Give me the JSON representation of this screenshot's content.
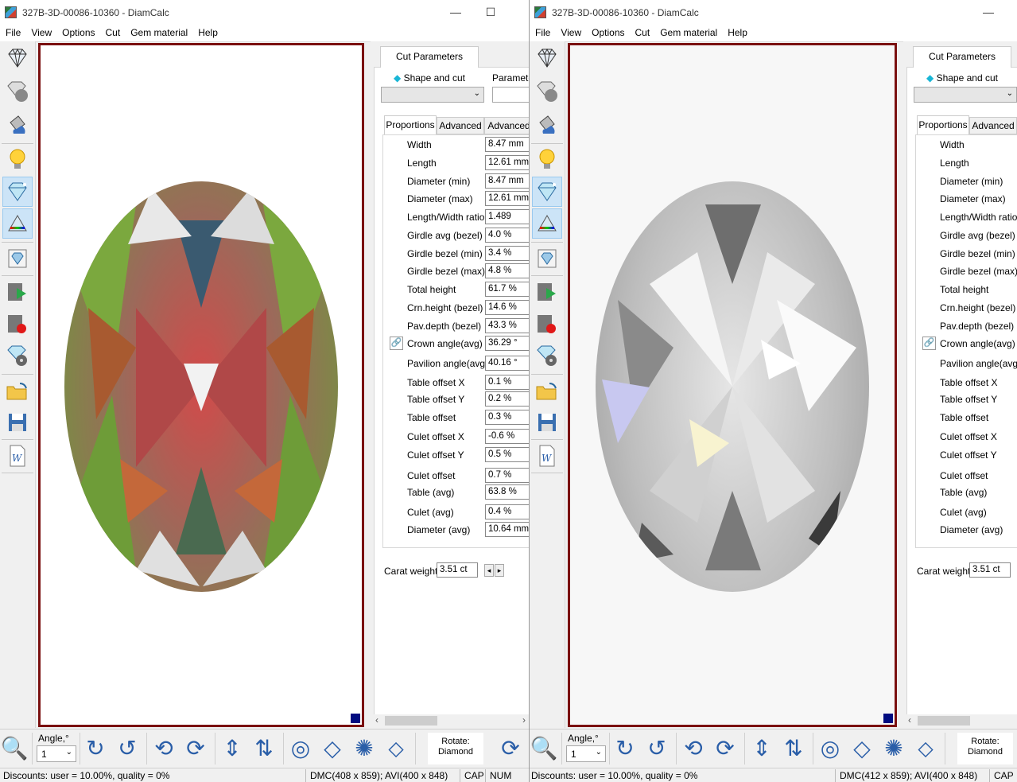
{
  "app": {
    "title": "327B-3D-00086-10360 - DiamCalc",
    "minimize_glyph": "—",
    "maximize_glyph": "☐",
    "menu": [
      "File",
      "View",
      "Options",
      "Cut",
      "Gem material",
      "Help"
    ]
  },
  "toolbar": {
    "icons": [
      "diamond-wireframe-icon",
      "diamond-sphere-icon",
      "paint-bucket-icon",
      "light-bulb-icon",
      "diamond-sparkle-icon",
      "spectrum-prism-icon",
      "diamond-picture-icon",
      "video-play-icon",
      "video-record-icon",
      "diamond-film-reel-icon",
      "open-folder-icon",
      "save-floppy-icon",
      "word-document-icon"
    ]
  },
  "panel": {
    "tab_cut_parameters": "Cut Parameters",
    "shape_and_cut_label": "Shape and cut",
    "parameters_label": "Parameter",
    "subtabs": [
      "Proportions",
      "Advanced",
      "Advanced"
    ],
    "rows": [
      {
        "label": "Width",
        "value": "8.47 mm"
      },
      {
        "label": "Length",
        "value": "12.61 mm"
      },
      {
        "label": "Diameter (min)",
        "value": "8.47 mm"
      },
      {
        "label": "Diameter (max)",
        "value": "12.61 mm"
      },
      {
        "label": "Length/Width ratio",
        "value": "1.489"
      },
      {
        "label": "Girdle avg (bezel)",
        "value": "4.0 %"
      },
      {
        "label": "Girdle bezel (min)",
        "value": "3.4 %"
      },
      {
        "label": "Girdle bezel (max)",
        "value": "4.8 %"
      },
      {
        "label": "Total height",
        "value": "61.7 %"
      },
      {
        "label": "Crn.height (bezel)",
        "value": "14.6 %"
      },
      {
        "label": "Pav.depth (bezel)",
        "value": "43.3 %"
      },
      {
        "label": "Crown angle(avg)",
        "value": "36.29 °"
      },
      {
        "label": "Pavilion angle(avg)",
        "value": "40.16 °"
      },
      {
        "label": "Table offset X",
        "value": "0.1 %"
      },
      {
        "label": "Table offset Y",
        "value": "0.2 %"
      },
      {
        "label": "Table offset",
        "value": "0.3 %"
      },
      {
        "label": "Culet offset X",
        "value": "-0.6 %"
      },
      {
        "label": "Culet offset Y",
        "value": "0.5 %"
      },
      {
        "label": "Culet offset",
        "value": "0.7 %"
      },
      {
        "label": "Table (avg)",
        "value": "63.8 %"
      },
      {
        "label": "Culet (avg)",
        "value": "0.4 %"
      },
      {
        "label": "Diameter (avg)",
        "value": "10.64 mm"
      }
    ],
    "carat_label": "Carat weight",
    "carat_value": "3.51 ct",
    "carat_left_arrow": "◂",
    "carat_right_arrow": "▸"
  },
  "bottom": {
    "angle_label": "Angle,°",
    "angle_value": "1",
    "rotate_label": "Rotate:",
    "rotate_target": "Diamond",
    "icons": [
      "zoom-magnifier-icon",
      "rotate-cw-icon",
      "rotate-ccw-icon",
      "flip-vertical-axis-left-icon",
      "flip-vertical-axis-right-icon",
      "flip-horizontal-axis-down-icon",
      "flip-horizontal-axis-up-icon",
      "view-top-icon",
      "view-side-icon",
      "view-bottom-icon",
      "view-pavilion-icon",
      "person-rotate-icon"
    ]
  },
  "status": {
    "left": {
      "discounts": "Discounts: user = 10.00%, quality = 0%",
      "dimensions": "DMC(408 x 859); AVI(400 x 848)",
      "cap": "CAP",
      "num": "NUM"
    },
    "right": {
      "discounts": "Discounts: user = 10.00%, quality = 0%",
      "dimensions": "DMC(412 x 859); AVI(400 x 848)",
      "cap": "CAP"
    }
  },
  "colors": {
    "viewport_border": "#7a1010",
    "selection": "#cce4f7",
    "corner_marker": "#000c80"
  }
}
